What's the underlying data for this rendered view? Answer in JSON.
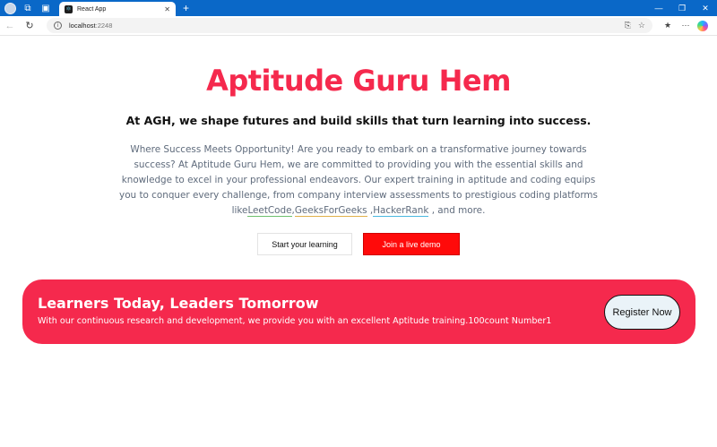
{
  "browser": {
    "tab_title": "React App",
    "url_host": "localhost",
    "url_port": ":2248"
  },
  "hero": {
    "title": "Aptitude Guru Hem",
    "subtitle": "At AGH, we shape futures and build skills that turn learning into success.",
    "description_prefix": "Where Success Meets Opportunity! Are you ready to embark on a transformative journey towards success? At Aptitude Guru Hem, we are committed to providing you with the essential skills and knowledge to excel in your professional endeavors. Our expert training in aptitude and coding equips you to conquer every challenge, from company interview assessments to prestigious coding platforms like",
    "links": [
      "LeetCode",
      "GeeksForGeeks",
      "HackerRank"
    ],
    "sep1": ",",
    "sep2": " ,",
    "description_suffix": " , and more.",
    "start_button": "Start your learning",
    "demo_button": "Join a live demo"
  },
  "banner": {
    "title": "Learners Today, Leaders Tomorrow",
    "text": "With our continuous research and development, we provide you with an excellent Aptitude training.100count Number1",
    "register_button": "Register Now"
  },
  "colors": {
    "brand_red": "#f5294d",
    "demo_red": "#ff0a0a",
    "titlebar_blue": "#0a68c8"
  },
  "icons": [
    "profile-avatar",
    "workspaces-icon",
    "tab-actions-icon",
    "react-favicon",
    "close-icon",
    "new-tab-icon",
    "minimize-icon",
    "restore-icon",
    "window-close-icon",
    "back-icon",
    "reload-icon",
    "info-icon",
    "read-aloud-icon",
    "favorite-star-icon",
    "favorites-icon",
    "more-icon",
    "copilot-icon"
  ]
}
